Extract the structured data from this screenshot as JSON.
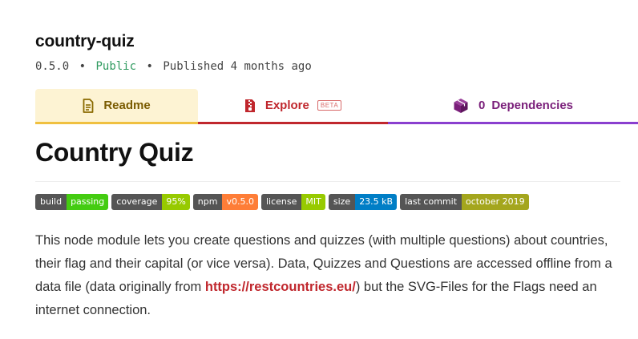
{
  "package": {
    "name": "country-quiz",
    "version": "0.5.0",
    "visibility": "Public",
    "bullet": "•",
    "published": "Published 4 months ago"
  },
  "tabs": [
    {
      "label": "Readme",
      "icon": "readme-file-icon",
      "color": "#7a5b00"
    },
    {
      "label": "Explore",
      "icon": "explore-zip-file-icon",
      "badge": "BETA",
      "color": "#c0272d"
    },
    {
      "count": "0",
      "label": "Dependencies",
      "icon": "dependencies-box-icon",
      "color": "#7a1f7a"
    }
  ],
  "readme": {
    "title": "Country Quiz",
    "badges": [
      {
        "label": "build",
        "value": "passing",
        "color": "#44cc11"
      },
      {
        "label": "coverage",
        "value": "95%",
        "color": "#97ca00"
      },
      {
        "label": "npm",
        "value": "v0.5.0",
        "color": "#fe7d37"
      },
      {
        "label": "license",
        "value": "MIT",
        "color": "#97ca00"
      },
      {
        "label": "size",
        "value": "23.5 kB",
        "color": "#007ec6"
      },
      {
        "label": "last commit",
        "value": "october 2019",
        "color": "#a4a61d"
      }
    ],
    "description_before": "This node module lets you create questions and quizzes (with multiple questions) about countries, their flag and their capital (or vice versa). Data, Quizzes and Questions are accessed offline from a data file (data originally from ",
    "link": "https://restcountries.eu/",
    "description_after": ") but the SVG-Files for the Flags need an internet connection."
  }
}
